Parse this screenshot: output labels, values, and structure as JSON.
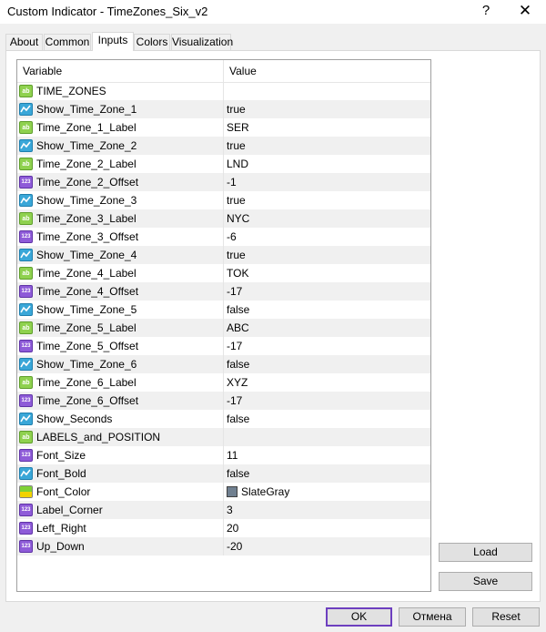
{
  "window": {
    "title": "Custom Indicator - TimeZones_Six_v2",
    "help_glyph": "?",
    "close_glyph": "✕"
  },
  "tabs": [
    {
      "label": "About",
      "active": false
    },
    {
      "label": "Common",
      "active": false
    },
    {
      "label": "Inputs",
      "active": true
    },
    {
      "label": "Colors",
      "active": false
    },
    {
      "label": "Visualization",
      "active": false
    }
  ],
  "grid": {
    "headers": {
      "variable": "Variable",
      "value": "Value"
    },
    "rows": [
      {
        "icon": "ab",
        "variable": "TIME_ZONES",
        "value": ""
      },
      {
        "icon": "bool",
        "variable": "Show_Time_Zone_1",
        "value": "true"
      },
      {
        "icon": "ab",
        "variable": "Time_Zone_1_Label",
        "value": "SER"
      },
      {
        "icon": "bool",
        "variable": "Show_Time_Zone_2",
        "value": "true"
      },
      {
        "icon": "ab",
        "variable": "Time_Zone_2_Label",
        "value": "LND"
      },
      {
        "icon": "num",
        "variable": "Time_Zone_2_Offset",
        "value": "-1"
      },
      {
        "icon": "bool",
        "variable": "Show_Time_Zone_3",
        "value": "true"
      },
      {
        "icon": "ab",
        "variable": "Time_Zone_3_Label",
        "value": "NYC"
      },
      {
        "icon": "num",
        "variable": "Time_Zone_3_Offset",
        "value": "-6"
      },
      {
        "icon": "bool",
        "variable": "Show_Time_Zone_4",
        "value": "true"
      },
      {
        "icon": "ab",
        "variable": "Time_Zone_4_Label",
        "value": "TOK"
      },
      {
        "icon": "num",
        "variable": "Time_Zone_4_Offset",
        "value": "-17"
      },
      {
        "icon": "bool",
        "variable": "Show_Time_Zone_5",
        "value": "false"
      },
      {
        "icon": "ab",
        "variable": "Time_Zone_5_Label",
        "value": "ABC"
      },
      {
        "icon": "num",
        "variable": "Time_Zone_5_Offset",
        "value": "-17"
      },
      {
        "icon": "bool",
        "variable": "Show_Time_Zone_6",
        "value": "false"
      },
      {
        "icon": "ab",
        "variable": "Time_Zone_6_Label",
        "value": "XYZ"
      },
      {
        "icon": "num",
        "variable": "Time_Zone_6_Offset",
        "value": "-17"
      },
      {
        "icon": "bool",
        "variable": "Show_Seconds",
        "value": "false"
      },
      {
        "icon": "ab",
        "variable": "LABELS_and_POSITION",
        "value": ""
      },
      {
        "icon": "num",
        "variable": "Font_Size",
        "value": "11"
      },
      {
        "icon": "bool",
        "variable": "Font_Bold",
        "value": "false"
      },
      {
        "icon": "color",
        "variable": "Font_Color",
        "value": "SlateGray",
        "swatch": "#708090"
      },
      {
        "icon": "num",
        "variable": "Label_Corner",
        "value": "3"
      },
      {
        "icon": "num",
        "variable": "Left_Right",
        "value": "20"
      },
      {
        "icon": "num",
        "variable": "Up_Down",
        "value": "-20"
      }
    ]
  },
  "icon_glyphs": {
    "ab": "ab",
    "num": "123"
  },
  "side_buttons": {
    "load": "Load",
    "save": "Save"
  },
  "footer": {
    "ok": "OK",
    "cancel": "Отмена",
    "reset": "Reset"
  },
  "colors": {
    "ok_border": "#6d3fbf",
    "alt_row": "#f0f0f0"
  }
}
